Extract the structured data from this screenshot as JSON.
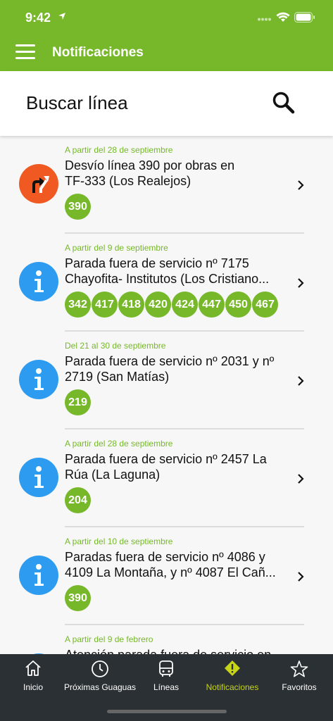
{
  "status_bar": {
    "time": "9:42"
  },
  "header": {
    "title": "Notificaciones"
  },
  "search": {
    "placeholder": "Buscar línea"
  },
  "colors": {
    "brand_green": "#76b82a",
    "detour_orange": "#f05a22",
    "info_blue": "#2d9cf0",
    "tab_active": "#c7d516",
    "tabbar_bg": "#2a3034"
  },
  "notifications": [
    {
      "date": "A partir del 28 de septiembre",
      "title_line1": "Desvío línea 390 por obras en",
      "title_line2": "TF-333 (Los Realejos)",
      "icon": "detour-icon",
      "lines": [
        "390"
      ]
    },
    {
      "date": "A partir del 9 de septiembre",
      "title_line1": "Parada fuera de servicio nº 7175",
      "title_line2": "Chayofita- Institutos (Los Cristiano...",
      "icon": "info-icon",
      "lines": [
        "342",
        "417",
        "418",
        "420",
        "424",
        "447",
        "450",
        "467"
      ]
    },
    {
      "date": "Del 21 al 30 de septiembre",
      "title_line1": "Parada fuera de servicio nº 2031 y nº",
      "title_line2": "2719 (San Matías)",
      "icon": "info-icon",
      "lines": [
        "219"
      ]
    },
    {
      "date": "A partir del 28 de septiembre",
      "title_line1": "Parada fuera de servicio nº 2457 La",
      "title_line2": "Rúa (La Laguna)",
      "icon": "info-icon",
      "lines": [
        "204"
      ]
    },
    {
      "date": "A partir del 10 de septiembre",
      "title_line1": "Paradas fuera de servicio nº 4086 y",
      "title_line2": "4109 La Montaña, y nº 4087 El Cañ...",
      "icon": "info-icon",
      "lines": [
        "390"
      ]
    },
    {
      "date": "A partir del 9 de febrero",
      "title_line1": "Atención parada fuera de servicio en",
      "title_line2": "",
      "icon": "info-icon",
      "lines": []
    }
  ],
  "tabs": [
    {
      "label": "Inicio",
      "icon": "home-icon",
      "active": false
    },
    {
      "label": "Próximas Guaguas",
      "icon": "clock-icon",
      "active": false
    },
    {
      "label": "Líneas",
      "icon": "bus-icon",
      "active": false
    },
    {
      "label": "Notificaciones",
      "icon": "warning-icon",
      "active": true
    },
    {
      "label": "Favoritos",
      "icon": "star-icon",
      "active": false
    }
  ]
}
